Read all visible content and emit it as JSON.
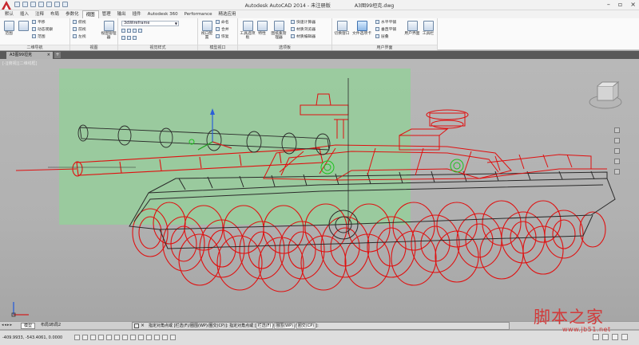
{
  "window": {
    "title": "Autodesk AutoCAD 2014 - 未注册版",
    "filename": "A3图99坦克.dwg",
    "search_placeholder": ""
  },
  "ribbon_tabs": [
    "默认",
    "插入",
    "注释",
    "布局",
    "参数化",
    "视图",
    "管理",
    "输出",
    "插件",
    "Autodesk 360",
    "Performance",
    "精选应用"
  ],
  "active_tab": "视图",
  "ribbon": {
    "nav": {
      "title": "二维导航",
      "items": [
        "平移",
        "动态观察",
        "范围"
      ],
      "big": [
        "范围",
        "SteeringWheels"
      ]
    },
    "views": {
      "title": "视图",
      "items": [
        "俯视",
        "前视",
        "左视"
      ],
      "big": "视图管理器"
    },
    "visual_styles": {
      "title": "视觉样式",
      "dropdown": "3dWireframe"
    },
    "viewports": {
      "title": "模型视口",
      "items": [
        "视口配置",
        "命名",
        "合并",
        "恢复"
      ]
    },
    "palettes": {
      "title": "选项板",
      "items": [
        "工具选项板",
        "特性",
        "图纸集管理器",
        "快速计算器",
        "材质浏览器",
        "材质编辑器",
        "特性匹配"
      ]
    },
    "windows": {
      "title": "用户界面",
      "items": [
        "切换窗口",
        "文件选项卡",
        "水平平铺",
        "垂直平铺",
        "层叠",
        "用户界面",
        "工具栏"
      ]
    }
  },
  "file_tab": "A3图99坦克",
  "viewport_label": "[-][俯视][二维线框]",
  "layout_tabs": [
    "模型",
    "布局1",
    "布局2"
  ],
  "command_line": {
    "text": "指定对角点或 [栏选(F)/圈围(WP)/圈交(CP)]: 指定对角点或",
    "options": [
      "栏选(F)",
      "圈围(WP)",
      "圈交(CP)"
    ]
  },
  "status_bar": {
    "coords": "-409.9933, -543.4061, 0.0000"
  },
  "watermark": {
    "text": "脚本之家",
    "url": "www.jb51.net"
  },
  "colors": {
    "sheet": "#98cc9c",
    "wireframe_red": "#e01010",
    "wireframe_dark": "#2a2a2a",
    "accent_green": "#1ec11e"
  }
}
